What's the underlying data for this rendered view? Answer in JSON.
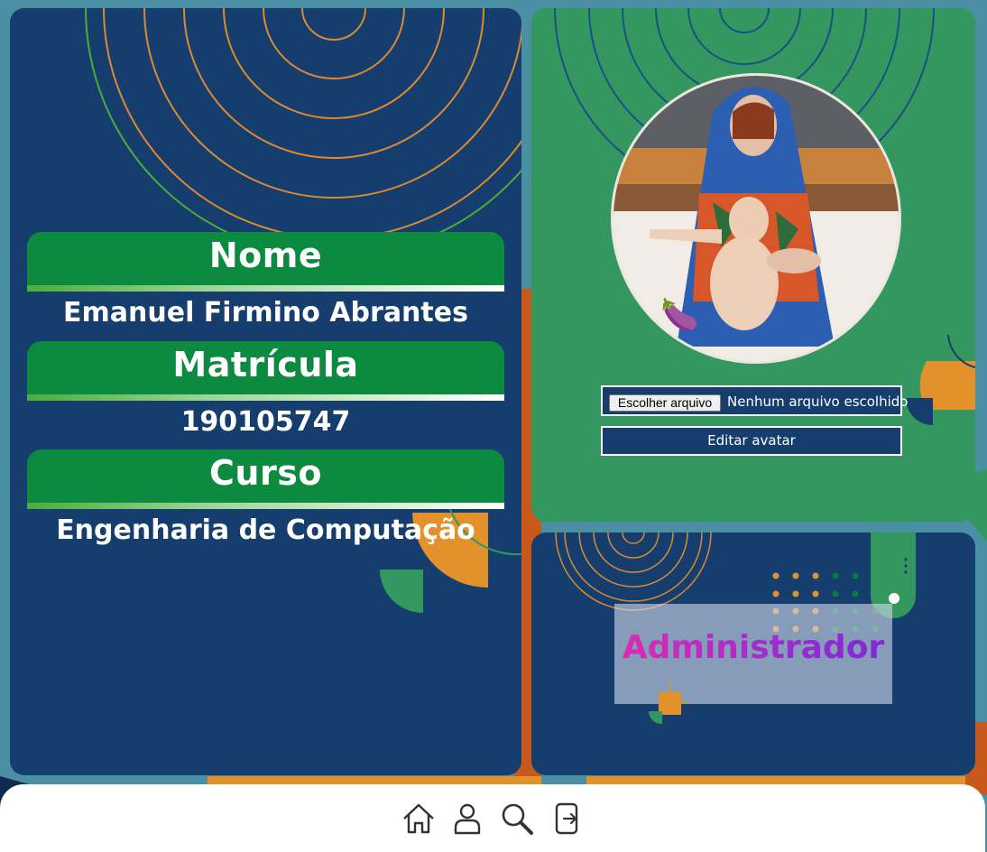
{
  "profile": {
    "name_label": "Nome",
    "name_value": "Emanuel Firmino Abrantes",
    "registration_label": "Matrícula",
    "registration_value": "190105747",
    "course_label": "Curso",
    "course_value": "Engenharia de Computação"
  },
  "avatar": {
    "emoji": "🍆",
    "file_button_label": "Escolher arquivo",
    "file_status": "Nenhum arquivo escolhido",
    "edit_button_label": "Editar avatar"
  },
  "role": {
    "label": "Administrador"
  },
  "nav": {
    "items": [
      {
        "icon": "home-icon"
      },
      {
        "icon": "user-icon"
      },
      {
        "icon": "search-icon"
      },
      {
        "icon": "logout-icon"
      }
    ]
  },
  "colors": {
    "page_background": "#4a8fa3",
    "panel_blue": "#153e6e",
    "panel_green": "#33975f",
    "header_green": "#0b8a40",
    "accent_orange": "#e3922b",
    "role_gradient_start": "#e02bb0",
    "role_gradient_end": "#7a2ad8"
  }
}
